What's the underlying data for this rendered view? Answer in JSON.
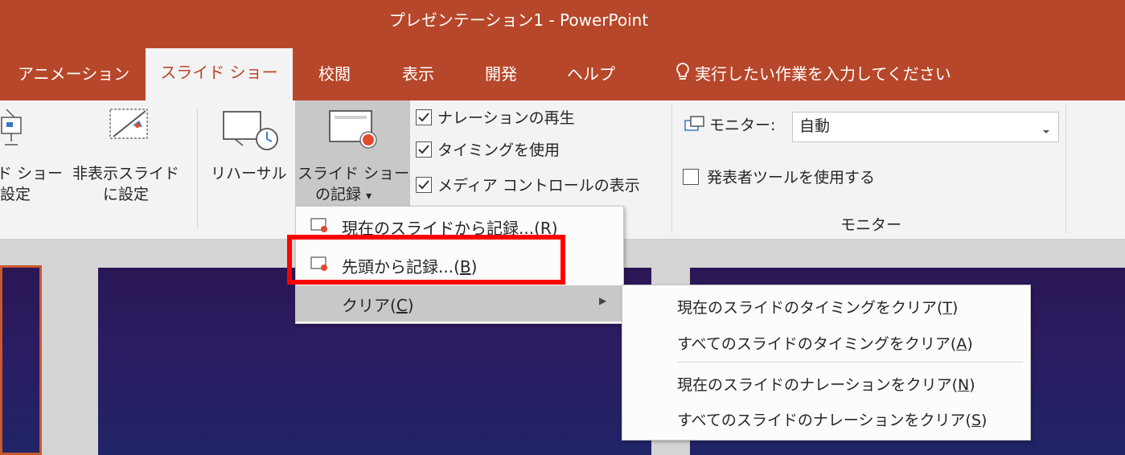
{
  "window": {
    "title": "プレゼンテーション1 - PowerPoint"
  },
  "tabs": [
    {
      "label": "アニメーション",
      "active": false
    },
    {
      "label": "スライド ショー",
      "active": true
    },
    {
      "label": "校閲",
      "active": false
    },
    {
      "label": "表示",
      "active": false
    },
    {
      "label": "開発",
      "active": false
    },
    {
      "label": "ヘルプ",
      "active": false
    }
  ],
  "tell_me": {
    "label": "実行したい作業を入力してください"
  },
  "ribbon": {
    "setup_slideshow": {
      "line1": "ド ショー",
      "line2": "設定"
    },
    "hide_slide": {
      "line1": "非表示スライド",
      "line2": "に設定"
    },
    "rehearse": {
      "label": "リハーサル"
    },
    "record": {
      "line1": "スライド ショー",
      "line2": "の記録",
      "arrow": "▾"
    },
    "checkboxes": [
      {
        "label": "ナレーションの再生",
        "checked": true
      },
      {
        "label": "タイミングを使用",
        "checked": true
      },
      {
        "label": "メディア コントロールの表示",
        "checked": true
      }
    ],
    "monitor": {
      "label": "モニター:",
      "value": "自動",
      "presenter_view": {
        "label": "発表者ツールを使用する",
        "checked": false
      },
      "group_label": "モニター"
    }
  },
  "menu": {
    "items": [
      {
        "text": "現在のスライドから記録...(",
        "key": "R",
        "close": ")"
      },
      {
        "text": "先頭から記録...(",
        "key": "B",
        "close": ")"
      },
      {
        "text": "クリア(",
        "key": "C",
        "close": ")",
        "submenu_arrow": "▶"
      }
    ]
  },
  "submenu": {
    "items": [
      {
        "text": "現在のスライドのタイミングをクリア(",
        "key": "T",
        "close": ")"
      },
      {
        "text": "すべてのスライドのタイミングをクリア(",
        "key": "A",
        "close": ")"
      },
      {
        "text": "現在のスライドのナレーションをクリア(",
        "key": "N",
        "close": ")"
      },
      {
        "text": "すべてのスライドのナレーションをクリア(",
        "key": "S",
        "close": ")"
      }
    ]
  },
  "colors": {
    "accent": "#b7472a",
    "highlight": "#ff0000",
    "slide_bg": "#2a1755"
  }
}
